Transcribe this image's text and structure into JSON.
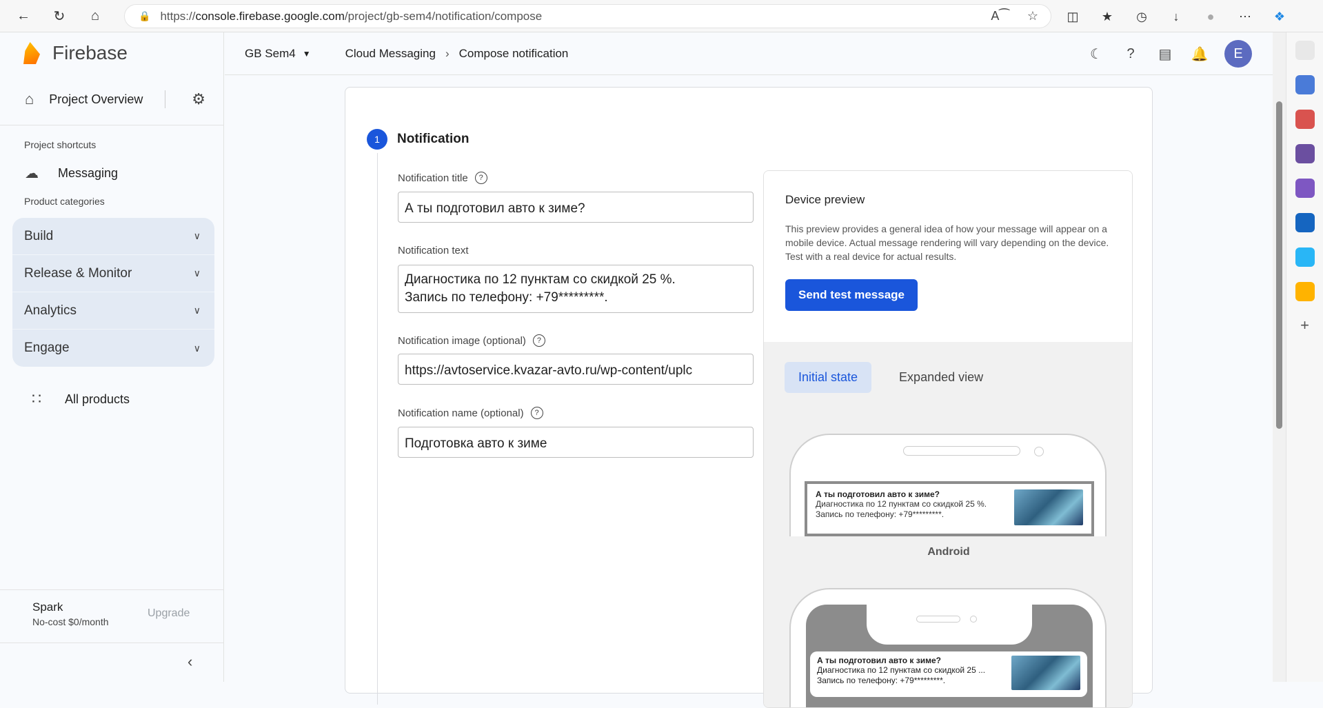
{
  "browser": {
    "url_prefix": "https://",
    "url_host": "console.firebase.google.com",
    "url_path": "/project/gb-sem4/notification/compose"
  },
  "sidebar": {
    "brand": "Firebase",
    "project_overview": "Project Overview",
    "shortcuts_caption": "Project shortcuts",
    "messaging": "Messaging",
    "categories_caption": "Product categories",
    "categories": [
      {
        "label": "Build"
      },
      {
        "label": "Release & Monitor"
      },
      {
        "label": "Analytics"
      },
      {
        "label": "Engage"
      }
    ],
    "all_products": "All products",
    "plan_name": "Spark",
    "plan_sub": "No-cost $0/month",
    "upgrade": "Upgrade"
  },
  "header": {
    "project": "GB Sem4",
    "crumb_1": "Cloud Messaging",
    "crumb_2": "Compose notification",
    "avatar_letter": "E"
  },
  "form": {
    "step_number": "1",
    "step_title": "Notification",
    "title_label": "Notification title",
    "title_value": "А ты подготовил авто к зиме?",
    "text_label": "Notification text",
    "text_line1": "Диагностика по 12 пунктам со скидкой 25 %.",
    "text_line2": "Запись по телефону: +79*********.",
    "image_label": "Notification image (optional)",
    "image_value": "https://avtoservice.kvazar-avto.ru/wp-content/uplc",
    "name_label": "Notification name (optional)",
    "name_value": "Подготовка авто к зиме"
  },
  "preview": {
    "title": "Device preview",
    "description": "This preview provides a general idea of how your message will appear on a mobile device. Actual message rendering will vary depending on the device. Test with a real device for actual results.",
    "send_button": "Send test message",
    "tab_initial": "Initial state",
    "tab_expanded": "Expanded view",
    "android_label": "Android",
    "notif_title": "А ты подготовил авто к зиме?",
    "notif_line1": "Диагностика по 12 пунктам со скидкой 25 %.",
    "notif_line2": "Запись по телефону: +79*********.",
    "ios_line1": "Диагностика по 12 пунктам со скидкой 25 ..."
  }
}
